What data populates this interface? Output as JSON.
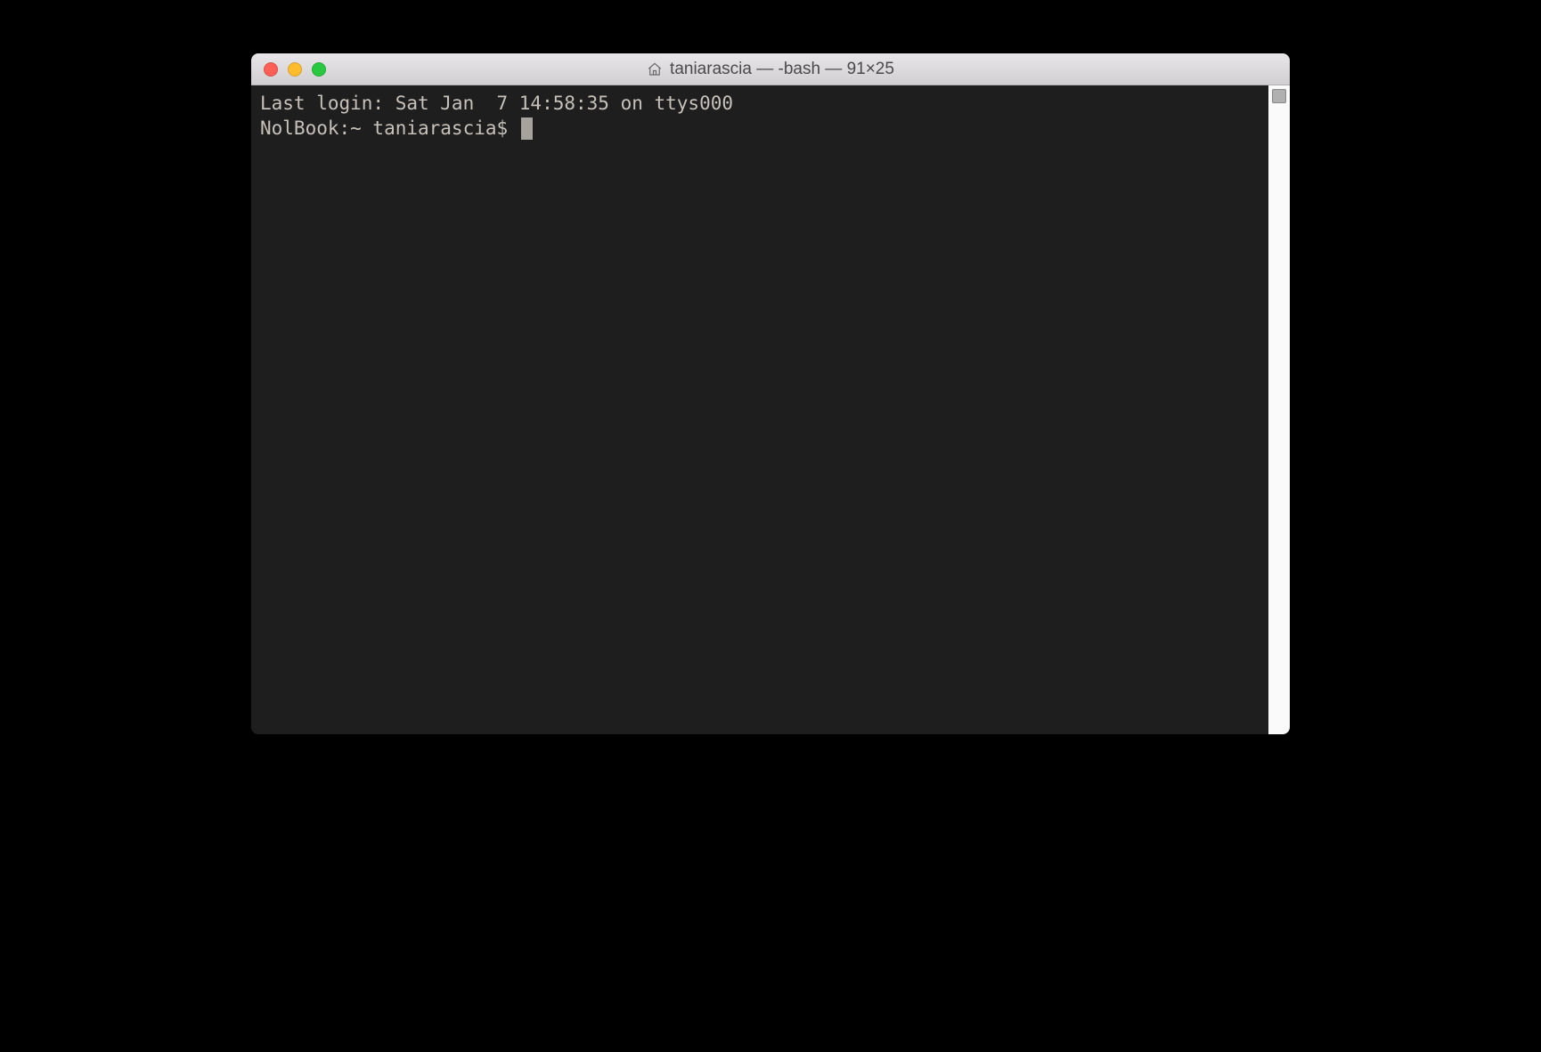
{
  "window": {
    "title": "taniarascia — -bash — 91×25"
  },
  "terminal": {
    "last_login": "Last login: Sat Jan  7 14:58:35 on ttys000",
    "prompt": "NolBook:~ taniarascia$ "
  },
  "colors": {
    "close": "#ff5f57",
    "minimize": "#ffbd2e",
    "maximize": "#28c940",
    "terminal_bg": "#1e1e1e",
    "terminal_fg": "#c7c1ba"
  }
}
